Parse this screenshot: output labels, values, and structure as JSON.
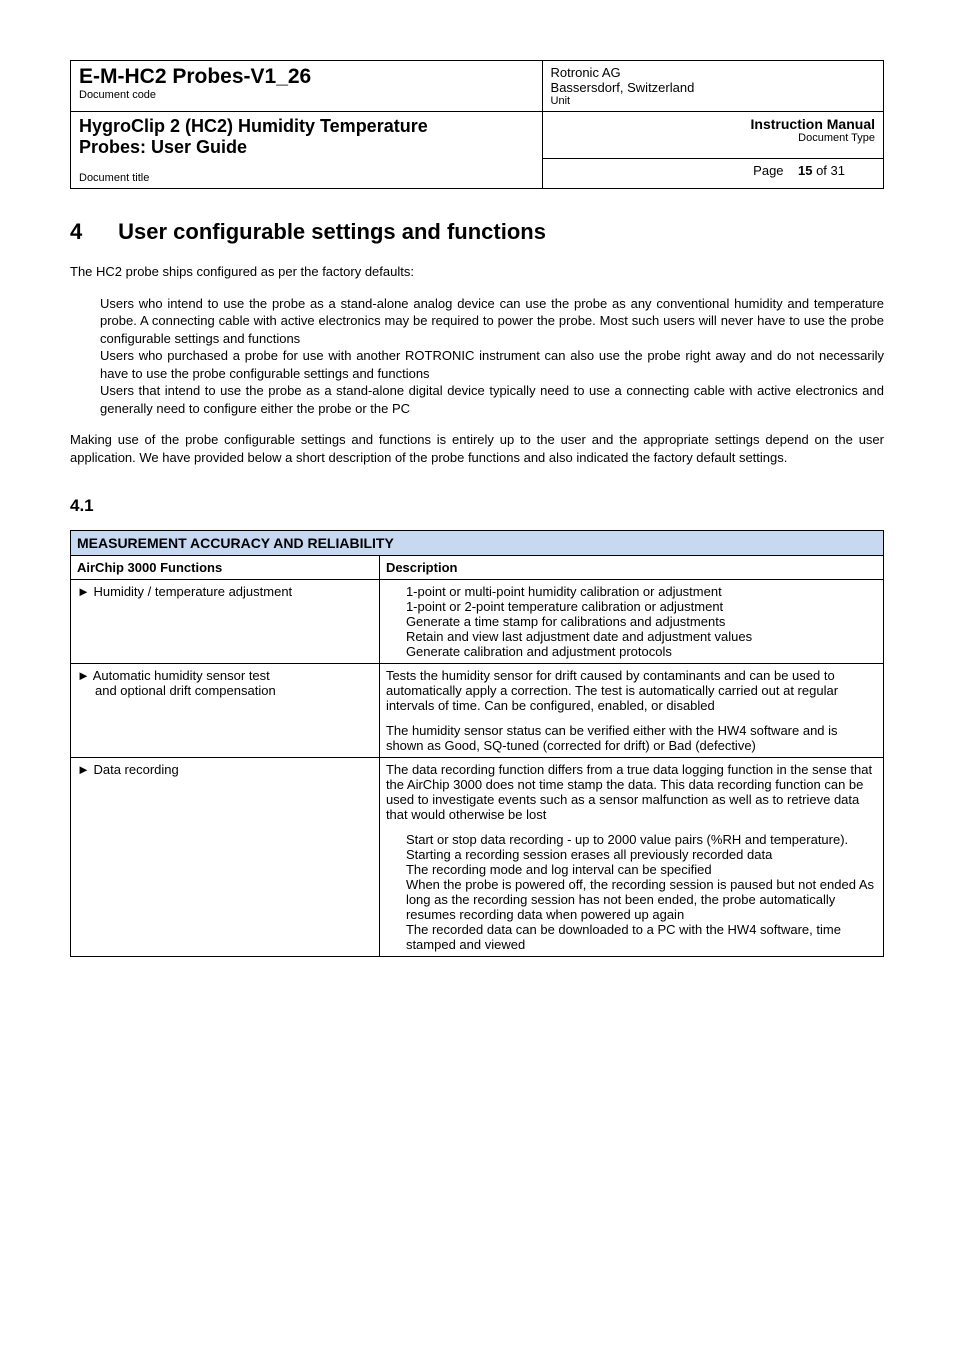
{
  "header": {
    "doc_code": "E-M-HC2 Probes-V1_26",
    "doc_code_label": "Document code",
    "company_line1": "Rotronic AG",
    "company_line2": "Bassersdorf, Switzerland",
    "unit_label": "Unit",
    "title_line1": "HygroClip 2 (HC2) Humidity Temperature",
    "title_line2": "Probes:  User Guide",
    "manual_label": "Instruction Manual",
    "doctype_label": "Document Type",
    "doc_title_label": "Document title",
    "page_label": "Page",
    "page_num": "15",
    "page_of": " of 31"
  },
  "section": {
    "num": "4",
    "title": "User configurable settings and functions",
    "intro": "The HC2 probe ships configured as per the factory defaults:",
    "bullets": [
      "Users who intend to use the probe as a stand-alone analog device can use the probe as any conventional humidity and temperature probe. A connecting cable with active electronics may be required to power the probe. Most such users will never have to use the probe configurable settings and functions",
      "Users who purchased a probe for use with another ROTRONIC instrument can also use the probe right away and do not necessarily have to use the probe configurable settings and functions",
      "Users that intend to use the probe as a stand-alone digital device typically need to use a connecting cable with active electronics and generally need to configure either the probe or the PC"
    ],
    "para2": "Making use of the probe configurable settings and functions is entirely up to the user and the appropriate settings depend on the user application. We have provided below a short description of the probe functions and also indicated the factory default settings."
  },
  "subsection": {
    "num": "4.1"
  },
  "table": {
    "title": "MEASUREMENT ACCURACY AND RELIABILITY",
    "head_col1": "AirChip 3000 Functions",
    "head_col2": "Description",
    "rows": [
      {
        "func": "► Humidity / temperature adjustment",
        "desc_lines": [
          "1-point or multi-point humidity calibration or adjustment",
          "1-point or 2-point temperature calibration or adjustment",
          "Generate a time stamp for calibrations and adjustments",
          "Retain and view last adjustment date and adjustment values",
          "Generate calibration and adjustment protocols"
        ]
      },
      {
        "func_line1": "► Automatic humidity sensor test",
        "func_line2": "and optional drift compensation",
        "desc_p1": "Tests the humidity sensor for drift caused by contaminants and can be used to automatically apply a correction. The test is automatically carried out at regular intervals of time. Can be configured, enabled, or disabled",
        "desc_p2": "The humidity sensor status can be verified either with the HW4 software and is shown as Good, SQ-tuned (corrected for drift) or Bad (defective)"
      },
      {
        "func": "► Data recording",
        "desc_p1": "The data recording function differs from a true data logging function in the sense that the AirChip 3000 does not time stamp the data. This data recording function can be used to investigate events such as a sensor malfunction as well as to retrieve data that would otherwise be lost",
        "desc_bullets": [
          "Start or stop data recording - up to 2000 value pairs (%RH and temperature). Starting a recording session erases all previously recorded data",
          "The recording mode and log interval can be specified",
          "When the probe is powered off, the recording session is paused but not ended  As long as the recording session has not been ended, the probe automatically resumes recording data when powered up again",
          "The recorded data can be downloaded to a PC with the HW4 software, time stamped and viewed"
        ]
      }
    ]
  }
}
